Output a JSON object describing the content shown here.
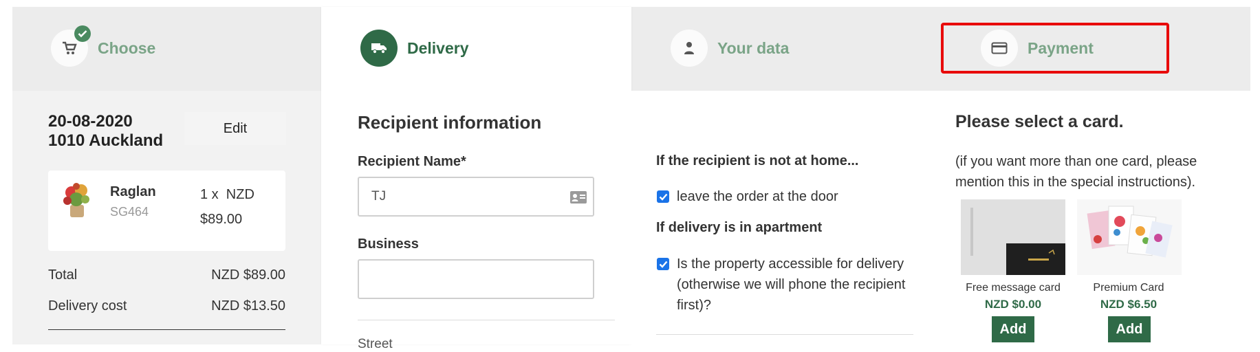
{
  "steps": [
    {
      "label": "Choose",
      "icon": "cart-icon",
      "done": true
    },
    {
      "label": "Delivery",
      "icon": "truck-icon",
      "active": true
    },
    {
      "label": "Your data",
      "icon": "person-icon"
    },
    {
      "label": "Payment",
      "icon": "credit-card-icon"
    }
  ],
  "summary": {
    "date": "20-08-2020",
    "location": "1010 Auckland",
    "edit_label": "Edit",
    "product": {
      "name": "Raglan",
      "sku": "SG464",
      "qty": "1 x  NZD",
      "price": "$89.00"
    },
    "total_label": "Total",
    "total_value": "NZD $89.00",
    "delivery_label": "Delivery cost",
    "delivery_value": "NZD $13.50"
  },
  "recipient": {
    "title": "Recipient information",
    "name_label": "Recipient Name*",
    "name_value": "TJ",
    "business_label": "Business",
    "business_value": "",
    "cut_label": "Street"
  },
  "options": {
    "not_home_title": "If the recipient is not at home...",
    "leave_door": "leave the order at the door",
    "apartment_title": "If delivery is in apartment",
    "accessible": "Is the property accessible for delivery (otherwise we will phone the recipient first)?"
  },
  "cards": {
    "title": "Please select a card.",
    "note": "(if you want more than one card, please mention this in the special instructions).",
    "items": [
      {
        "name": "Free message card",
        "price": "NZD $0.00",
        "add": "Add"
      },
      {
        "name": "Premium Card",
        "price": "NZD $6.50",
        "add": "Add"
      }
    ]
  },
  "colors": {
    "accent": "#2f6a47",
    "accent_light": "#7aa487",
    "highlight": "#e80b0b",
    "checkbox": "#1a73e8"
  }
}
